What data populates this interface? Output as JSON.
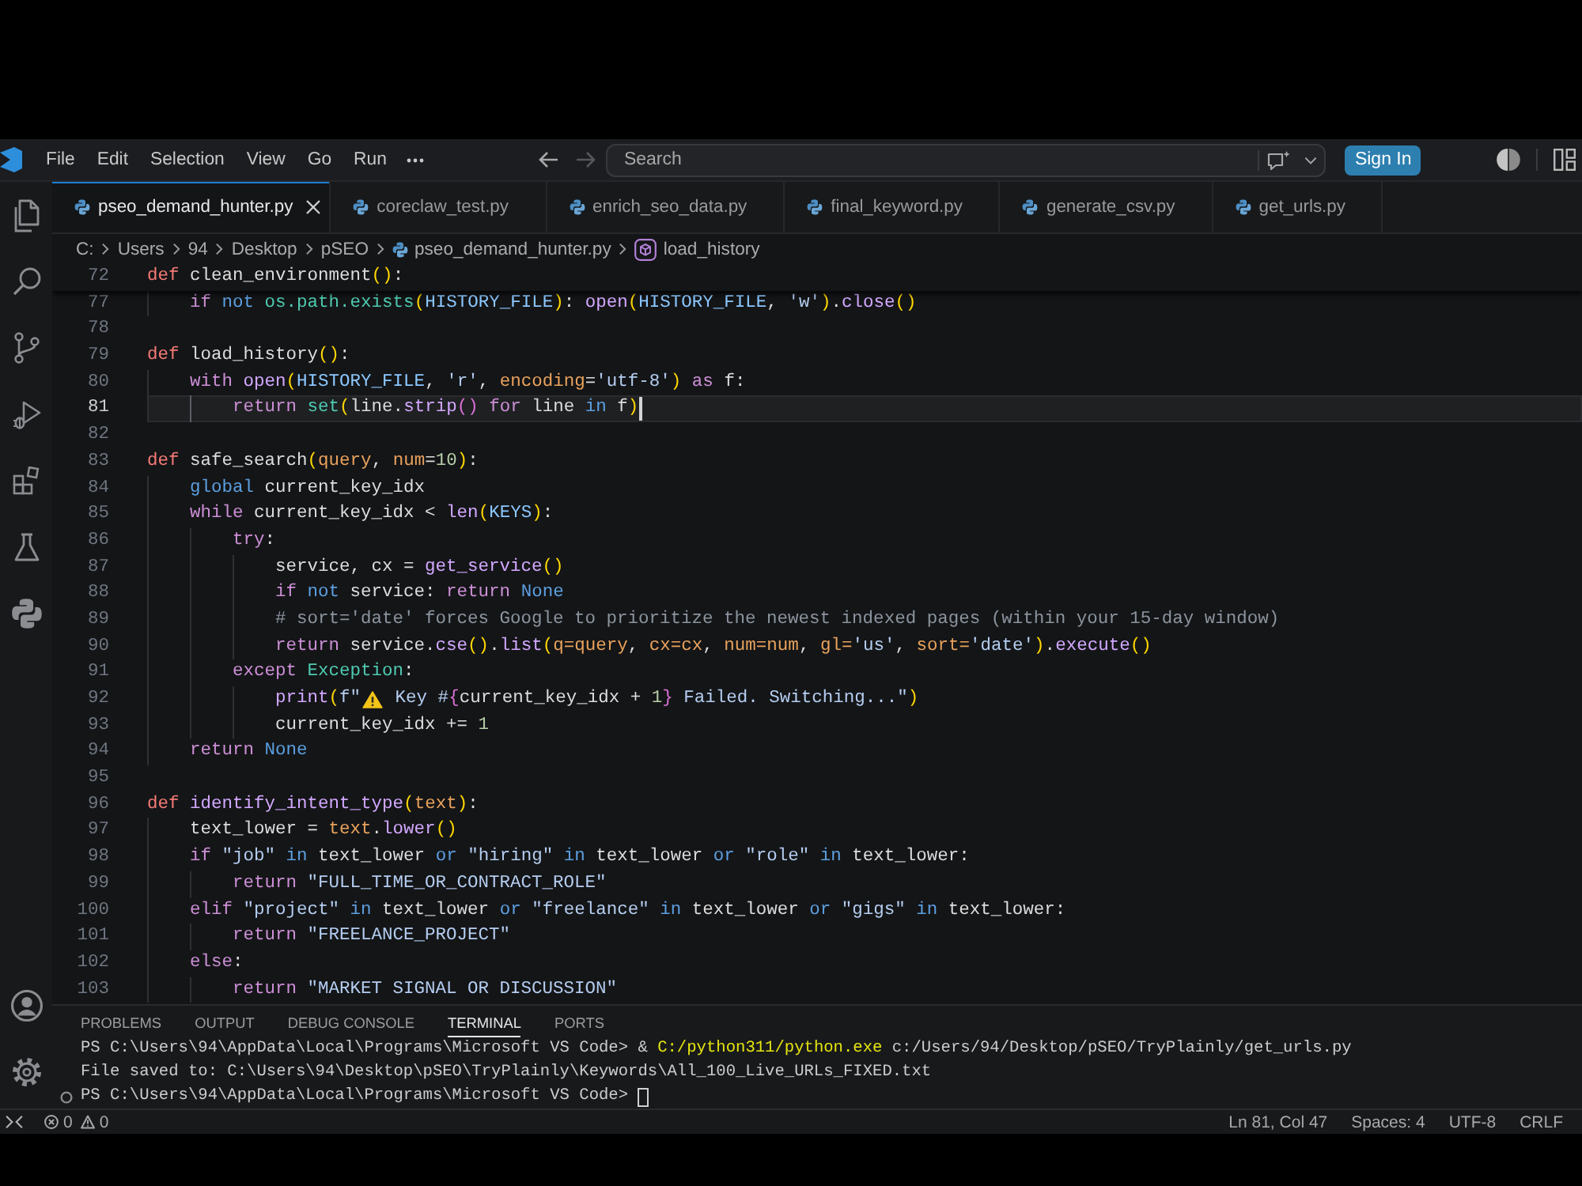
{
  "title_bar": {
    "menu": [
      "File",
      "Edit",
      "Selection",
      "View",
      "Go",
      "Run"
    ],
    "navigation": {
      "back": {
        "disabled": false
      },
      "forward": {
        "disabled": true
      }
    },
    "search": {
      "placeholder": "Search"
    },
    "sign_in": "Sign In"
  },
  "tabs": [
    {
      "label": "pseo_demand_hunter.py",
      "selected": true
    },
    {
      "label": "coreclaw_test.py",
      "selected": false
    },
    {
      "label": "enrich_seo_data.py",
      "selected": false
    },
    {
      "label": "final_keyword.py",
      "selected": false
    },
    {
      "label": "generate_csv.py",
      "selected": false
    },
    {
      "label": "get_urls.py",
      "selected": false
    }
  ],
  "breadcrumbs": [
    {
      "label": "C:",
      "kind": "folder"
    },
    {
      "label": "Users",
      "kind": "folder"
    },
    {
      "label": "94",
      "kind": "folder"
    },
    {
      "label": "Desktop",
      "kind": "folder"
    },
    {
      "label": "pSEO",
      "kind": "folder"
    },
    {
      "label": "pseo_demand_hunter.py",
      "kind": "file"
    },
    {
      "label": "load_history",
      "kind": "symbol"
    }
  ],
  "editor": {
    "sticky_line": {
      "number": "72",
      "tokens": [
        {
          "kind": "declaration",
          "text": "def"
        },
        {
          "kind": "plain",
          "text": " clean_environment"
        },
        {
          "kind": "bracket1",
          "text": "()"
        },
        {
          "kind": "plain",
          "text": ":"
        }
      ]
    },
    "lines": [
      {
        "number": "77",
        "current": false,
        "tokens": [
          {
            "kind": "control",
            "text": "    if"
          },
          {
            "kind": "keyword",
            "text": " not"
          },
          {
            "kind": "class",
            "text": " os.path.exists"
          },
          {
            "kind": "bracket1",
            "text": "("
          },
          {
            "kind": "constant",
            "text": "HISTORY_FILE"
          },
          {
            "kind": "bracket1",
            "text": ")"
          },
          {
            "kind": "plain",
            "text": ": "
          },
          {
            "kind": "function",
            "text": "open"
          },
          {
            "kind": "bracket1",
            "text": "("
          },
          {
            "kind": "constant",
            "text": "HISTORY_FILE"
          },
          {
            "kind": "plain",
            "text": ", "
          },
          {
            "kind": "string",
            "text": "'w'"
          },
          {
            "kind": "bracket1",
            "text": ")"
          },
          {
            "kind": "plain",
            "text": "."
          },
          {
            "kind": "function",
            "text": "close"
          },
          {
            "kind": "bracket1",
            "text": "()"
          }
        ]
      },
      {
        "number": "78",
        "current": false
      },
      {
        "number": "79",
        "current": false,
        "tokens": [
          {
            "kind": "declaration",
            "text": "def"
          },
          {
            "kind": "plain",
            "text": " load_history"
          },
          {
            "kind": "bracket1",
            "text": "()"
          },
          {
            "kind": "plain",
            "text": ":"
          }
        ]
      },
      {
        "number": "80",
        "current": false,
        "tokens": [
          {
            "kind": "control",
            "text": "    with"
          },
          {
            "kind": "function",
            "text": " open"
          },
          {
            "kind": "bracket1",
            "text": "("
          },
          {
            "kind": "constant",
            "text": "HISTORY_FILE"
          },
          {
            "kind": "plain",
            "text": ", "
          },
          {
            "kind": "string",
            "text": "'r'"
          },
          {
            "kind": "plain",
            "text": ", "
          },
          {
            "kind": "parameter",
            "text": "encoding"
          },
          {
            "kind": "plain",
            "text": "="
          },
          {
            "kind": "string",
            "text": "'utf-8'"
          },
          {
            "kind": "bracket1",
            "text": ")"
          },
          {
            "kind": "control",
            "text": " as"
          },
          {
            "kind": "plain",
            "text": " f:"
          }
        ]
      },
      {
        "number": "81",
        "current": true,
        "tokens": [
          {
            "kind": "control",
            "text": "        return"
          },
          {
            "kind": "class",
            "text": " set"
          },
          {
            "kind": "bracket1",
            "text": "("
          },
          {
            "kind": "plain",
            "text": "line."
          },
          {
            "kind": "function",
            "text": "strip"
          },
          {
            "kind": "bracket2",
            "text": "()"
          },
          {
            "kind": "control",
            "text": " for"
          },
          {
            "kind": "plain",
            "text": " line "
          },
          {
            "kind": "keyword",
            "text": "in"
          },
          {
            "kind": "plain",
            "text": " f"
          },
          {
            "kind": "bracket1",
            "text": ")"
          }
        ]
      },
      {
        "number": "82",
        "current": false
      },
      {
        "number": "83",
        "current": false,
        "tokens": [
          {
            "kind": "declaration",
            "text": "def"
          },
          {
            "kind": "plain",
            "text": " safe_search"
          },
          {
            "kind": "bracket1",
            "text": "("
          },
          {
            "kind": "parameter",
            "text": "query"
          },
          {
            "kind": "plain",
            "text": ", "
          },
          {
            "kind": "parameter",
            "text": "num"
          },
          {
            "kind": "plain",
            "text": "="
          },
          {
            "kind": "number",
            "text": "10"
          },
          {
            "kind": "bracket1",
            "text": ")"
          },
          {
            "kind": "plain",
            "text": ":"
          }
        ]
      },
      {
        "number": "84",
        "current": false,
        "tokens": [
          {
            "kind": "keyword",
            "text": "    global"
          },
          {
            "kind": "plain",
            "text": " current_key_idx"
          }
        ]
      },
      {
        "number": "85",
        "current": false,
        "tokens": [
          {
            "kind": "control",
            "text": "    while"
          },
          {
            "kind": "plain",
            "text": " current_key_idx < "
          },
          {
            "kind": "function",
            "text": "len"
          },
          {
            "kind": "bracket1",
            "text": "("
          },
          {
            "kind": "constant",
            "text": "KEYS"
          },
          {
            "kind": "bracket1",
            "text": ")"
          },
          {
            "kind": "plain",
            "text": ":"
          }
        ]
      },
      {
        "number": "86",
        "current": false,
        "tokens": [
          {
            "kind": "control",
            "text": "        try"
          },
          {
            "kind": "plain",
            "text": ":"
          }
        ]
      },
      {
        "number": "87",
        "current": false,
        "tokens": [
          {
            "kind": "plain",
            "text": "            service, cx = "
          },
          {
            "kind": "function",
            "text": "get_service"
          },
          {
            "kind": "bracket1",
            "text": "()"
          }
        ]
      },
      {
        "number": "88",
        "current": false,
        "tokens": [
          {
            "kind": "control",
            "text": "            if"
          },
          {
            "kind": "keyword",
            "text": " not"
          },
          {
            "kind": "plain",
            "text": " service: "
          },
          {
            "kind": "control",
            "text": "return"
          },
          {
            "kind": "keyword",
            "text": " None"
          }
        ]
      },
      {
        "number": "89",
        "current": false,
        "tokens": [
          {
            "kind": "comment",
            "text": "            # sort='date' forces Google to prioritize the newest indexed pages (within your 15-day window)"
          }
        ]
      },
      {
        "number": "90",
        "current": false,
        "tokens": [
          {
            "kind": "control",
            "text": "            return"
          },
          {
            "kind": "plain",
            "text": " service."
          },
          {
            "kind": "function",
            "text": "cse"
          },
          {
            "kind": "bracket1",
            "text": "()"
          },
          {
            "kind": "plain",
            "text": "."
          },
          {
            "kind": "function",
            "text": "list"
          },
          {
            "kind": "bracket1",
            "text": "("
          },
          {
            "kind": "parameter",
            "text": "q=query"
          },
          {
            "kind": "plain",
            "text": ", "
          },
          {
            "kind": "parameter",
            "text": "cx=cx"
          },
          {
            "kind": "plain",
            "text": ", "
          },
          {
            "kind": "parameter",
            "text": "num=num"
          },
          {
            "kind": "plain",
            "text": ", "
          },
          {
            "kind": "parameter",
            "text": "gl="
          },
          {
            "kind": "string",
            "text": "'us'"
          },
          {
            "kind": "plain",
            "text": ", "
          },
          {
            "kind": "parameter",
            "text": "sort="
          },
          {
            "kind": "string",
            "text": "'date'"
          },
          {
            "kind": "bracket1",
            "text": ")"
          },
          {
            "kind": "plain",
            "text": "."
          },
          {
            "kind": "function",
            "text": "execute"
          },
          {
            "kind": "bracket1",
            "text": "()"
          }
        ]
      },
      {
        "number": "91",
        "current": false,
        "tokens": [
          {
            "kind": "control",
            "text": "        except"
          },
          {
            "kind": "class",
            "text": " Exception"
          },
          {
            "kind": "plain",
            "text": ":"
          }
        ]
      },
      {
        "number": "92",
        "current": false,
        "tokens": [
          {
            "kind": "function",
            "text": "            print"
          },
          {
            "kind": "bracket1",
            "text": "("
          },
          {
            "kind": "string",
            "text": "f\""
          },
          {
            "kind": "warning_icon"
          },
          {
            "kind": "string",
            "text": " Key #"
          },
          {
            "kind": "bracket2",
            "text": "{"
          },
          {
            "kind": "plain",
            "text": "current_key_idx + "
          },
          {
            "kind": "number",
            "text": "1"
          },
          {
            "kind": "bracket2",
            "text": "}"
          },
          {
            "kind": "string",
            "text": " Failed. Switching...\""
          },
          {
            "kind": "bracket1",
            "text": ")"
          }
        ]
      },
      {
        "number": "93",
        "current": false,
        "tokens": [
          {
            "kind": "plain",
            "text": "            current_key_idx += "
          },
          {
            "kind": "number",
            "text": "1"
          }
        ]
      },
      {
        "number": "94",
        "current": false,
        "tokens": [
          {
            "kind": "control",
            "text": "    return"
          },
          {
            "kind": "keyword",
            "text": " None"
          }
        ]
      },
      {
        "number": "95",
        "current": false
      },
      {
        "number": "96",
        "current": false,
        "tokens": [
          {
            "kind": "declaration",
            "text": "def"
          },
          {
            "kind": "function",
            "text": " identify_intent_type"
          },
          {
            "kind": "bracket1",
            "text": "("
          },
          {
            "kind": "parameter",
            "text": "text"
          },
          {
            "kind": "bracket1",
            "text": ")"
          },
          {
            "kind": "plain",
            "text": ":"
          }
        ]
      },
      {
        "number": "97",
        "current": false,
        "tokens": [
          {
            "kind": "plain",
            "text": "    text_lower = "
          },
          {
            "kind": "parameter",
            "text": "text"
          },
          {
            "kind": "plain",
            "text": "."
          },
          {
            "kind": "function",
            "text": "lower"
          },
          {
            "kind": "bracket1",
            "text": "()"
          }
        ]
      },
      {
        "number": "98",
        "current": false,
        "tokens": [
          {
            "kind": "control",
            "text": "    if"
          },
          {
            "kind": "string",
            "text": " \"job\""
          },
          {
            "kind": "keyword",
            "text": " in"
          },
          {
            "kind": "plain",
            "text": " text_lower "
          },
          {
            "kind": "keyword",
            "text": "or"
          },
          {
            "kind": "string",
            "text": " \"hiring\""
          },
          {
            "kind": "keyword",
            "text": " in"
          },
          {
            "kind": "plain",
            "text": " text_lower "
          },
          {
            "kind": "keyword",
            "text": "or"
          },
          {
            "kind": "string",
            "text": " \"role\""
          },
          {
            "kind": "keyword",
            "text": " in"
          },
          {
            "kind": "plain",
            "text": " text_lower:"
          }
        ]
      },
      {
        "number": "99",
        "current": false,
        "tokens": [
          {
            "kind": "control",
            "text": "        return"
          },
          {
            "kind": "string",
            "text": " \"FULL_TIME_OR_CONTRACT_ROLE\""
          }
        ]
      },
      {
        "number": "100",
        "current": false,
        "tokens": [
          {
            "kind": "control",
            "text": "    elif"
          },
          {
            "kind": "string",
            "text": " \"project\""
          },
          {
            "kind": "keyword",
            "text": " in"
          },
          {
            "kind": "plain",
            "text": " text_lower "
          },
          {
            "kind": "keyword",
            "text": "or"
          },
          {
            "kind": "string",
            "text": " \"freelance\""
          },
          {
            "kind": "keyword",
            "text": " in"
          },
          {
            "kind": "plain",
            "text": " text_lower "
          },
          {
            "kind": "keyword",
            "text": "or"
          },
          {
            "kind": "string",
            "text": " \"gigs\""
          },
          {
            "kind": "keyword",
            "text": " in"
          },
          {
            "kind": "plain",
            "text": " text_lower:"
          }
        ]
      },
      {
        "number": "101",
        "current": false,
        "tokens": [
          {
            "kind": "control",
            "text": "        return"
          },
          {
            "kind": "string",
            "text": " \"FREELANCE_PROJECT\""
          }
        ]
      },
      {
        "number": "102",
        "current": false,
        "tokens": [
          {
            "kind": "control",
            "text": "    else"
          },
          {
            "kind": "plain",
            "text": ":"
          }
        ]
      },
      {
        "number": "103",
        "current": false,
        "tokens": [
          {
            "kind": "control",
            "text": "        return"
          },
          {
            "kind": "string",
            "text": " \"MARKET SIGNAL OR DISCUSSION\""
          }
        ]
      }
    ]
  },
  "panel": {
    "tabs": [
      {
        "label": "PROBLEMS",
        "selected": false
      },
      {
        "label": "OUTPUT",
        "selected": false
      },
      {
        "label": "DEBUG CONSOLE",
        "selected": false
      },
      {
        "label": "TERMINAL",
        "selected": true
      },
      {
        "label": "PORTS",
        "selected": false
      }
    ],
    "terminal": [
      {
        "kind": "command",
        "tokens": [
          {
            "kind": "plain",
            "text": "PS C:\\Users\\94\\AppData\\Local\\Programs\\Microsoft VS Code> & "
          },
          {
            "kind": "executable",
            "text": "C:/python311/python.exe"
          },
          {
            "kind": "plain",
            "text": " c:/Users/94/Desktop/pSEO/TryPlainly/get_urls.py"
          }
        ]
      },
      {
        "kind": "output",
        "tokens": [
          {
            "kind": "plain",
            "text": "File saved to: C:\\Users\\94\\Desktop\\pSEO\\TryPlainly\\Keywords\\All_100_Live_URLs_FIXED.txt"
          }
        ]
      },
      {
        "kind": "prompt",
        "tokens": [
          {
            "kind": "plain",
            "text": "PS C:\\Users\\94\\AppData\\Local\\Programs\\Microsoft VS Code>"
          }
        ]
      }
    ]
  },
  "status_bar": {
    "errors": "0",
    "warnings": "0",
    "items": [
      "Ln 81, Col 47",
      "Spaces: 4",
      "UTF-8",
      "CRLF"
    ]
  }
}
